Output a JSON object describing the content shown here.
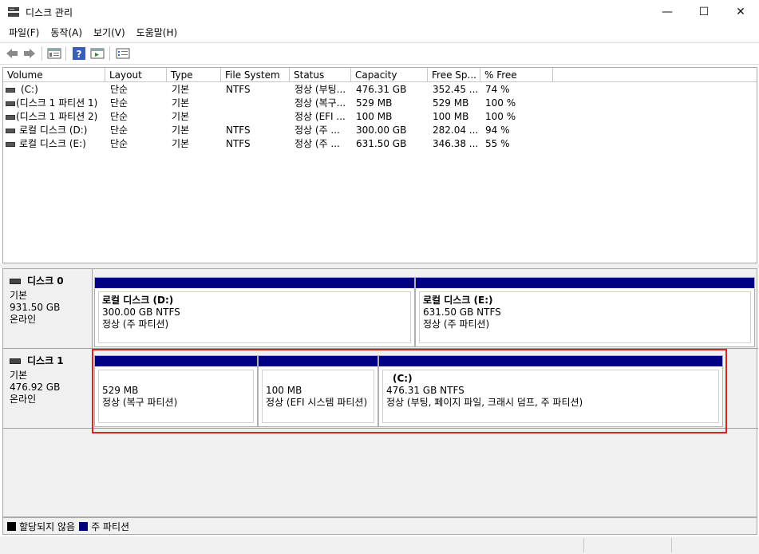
{
  "window": {
    "title": "디스크 관리",
    "min_glyph": "—",
    "max_glyph": "☐",
    "close_glyph": "✕"
  },
  "menu": [
    {
      "label": "파일(F)"
    },
    {
      "label": "동작(A)"
    },
    {
      "label": "보기(V)"
    },
    {
      "label": "도움말(H)"
    }
  ],
  "toolbar_icons": [
    "back-arrow-icon",
    "forward-arrow-icon",
    "properties-icon",
    "help-icon",
    "console-icon",
    "checklist-icon"
  ],
  "volume_table": {
    "headers": [
      "Volume",
      "Layout",
      "Type",
      "File System",
      "Status",
      "Capacity",
      "Free Sp...",
      "% Free"
    ],
    "rows": [
      [
        "(C:)",
        "단순",
        "기본",
        "NTFS",
        "정상 (부팅...",
        "476.31 GB",
        "352.45 ...",
        "74 %"
      ],
      [
        "(디스크 1 파티션 1)",
        "단순",
        "기본",
        "",
        "정상 (복구...",
        "529 MB",
        "529 MB",
        "100 %"
      ],
      [
        "(디스크 1 파티션 2)",
        "단순",
        "기본",
        "",
        "정상 (EFI ...",
        "100 MB",
        "100 MB",
        "100 %"
      ],
      [
        "로컬 디스크 (D:)",
        "단순",
        "기본",
        "NTFS",
        "정상 (주 ...",
        "300.00 GB",
        "282.04 ...",
        "94 %"
      ],
      [
        "로컬 디스크 (E:)",
        "단순",
        "기본",
        "NTFS",
        "정상 (주 ...",
        "631.50 GB",
        "346.38 ...",
        "55 %"
      ]
    ]
  },
  "disks": [
    {
      "name": "디스크 0",
      "type": "기본",
      "size": "931.50 GB",
      "state": "온라인",
      "partitions": [
        {
          "name": "로컬 디스크  (D:)",
          "size": "300.00 GB NTFS",
          "status": "정상 (주 파티션)"
        },
        {
          "name": "로컬 디스크  (E:)",
          "size": "631.50 GB NTFS",
          "status": "정상 (주 파티션)"
        }
      ]
    },
    {
      "name": "디스크 1",
      "type": "기본",
      "size": "476.92 GB",
      "state": "온라인",
      "partitions": [
        {
          "name": "",
          "size": "529 MB",
          "status": "정상 (복구 파티션)"
        },
        {
          "name": "",
          "size": "100 MB",
          "status": "정상 (EFI 시스템 파티션)"
        },
        {
          "name": "(C:)",
          "size": "476.31 GB NTFS",
          "status": "정상 (부팅, 페이지 파일, 크래시 덤프, 주 파티션)"
        }
      ]
    }
  ],
  "legend": {
    "unallocated": "할당되지 않음",
    "primary": "주 파티션",
    "unallocated_color": "#000000",
    "primary_color": "#000080"
  },
  "colors": {
    "partition_bar": "#000080",
    "highlight": "#e02020"
  }
}
